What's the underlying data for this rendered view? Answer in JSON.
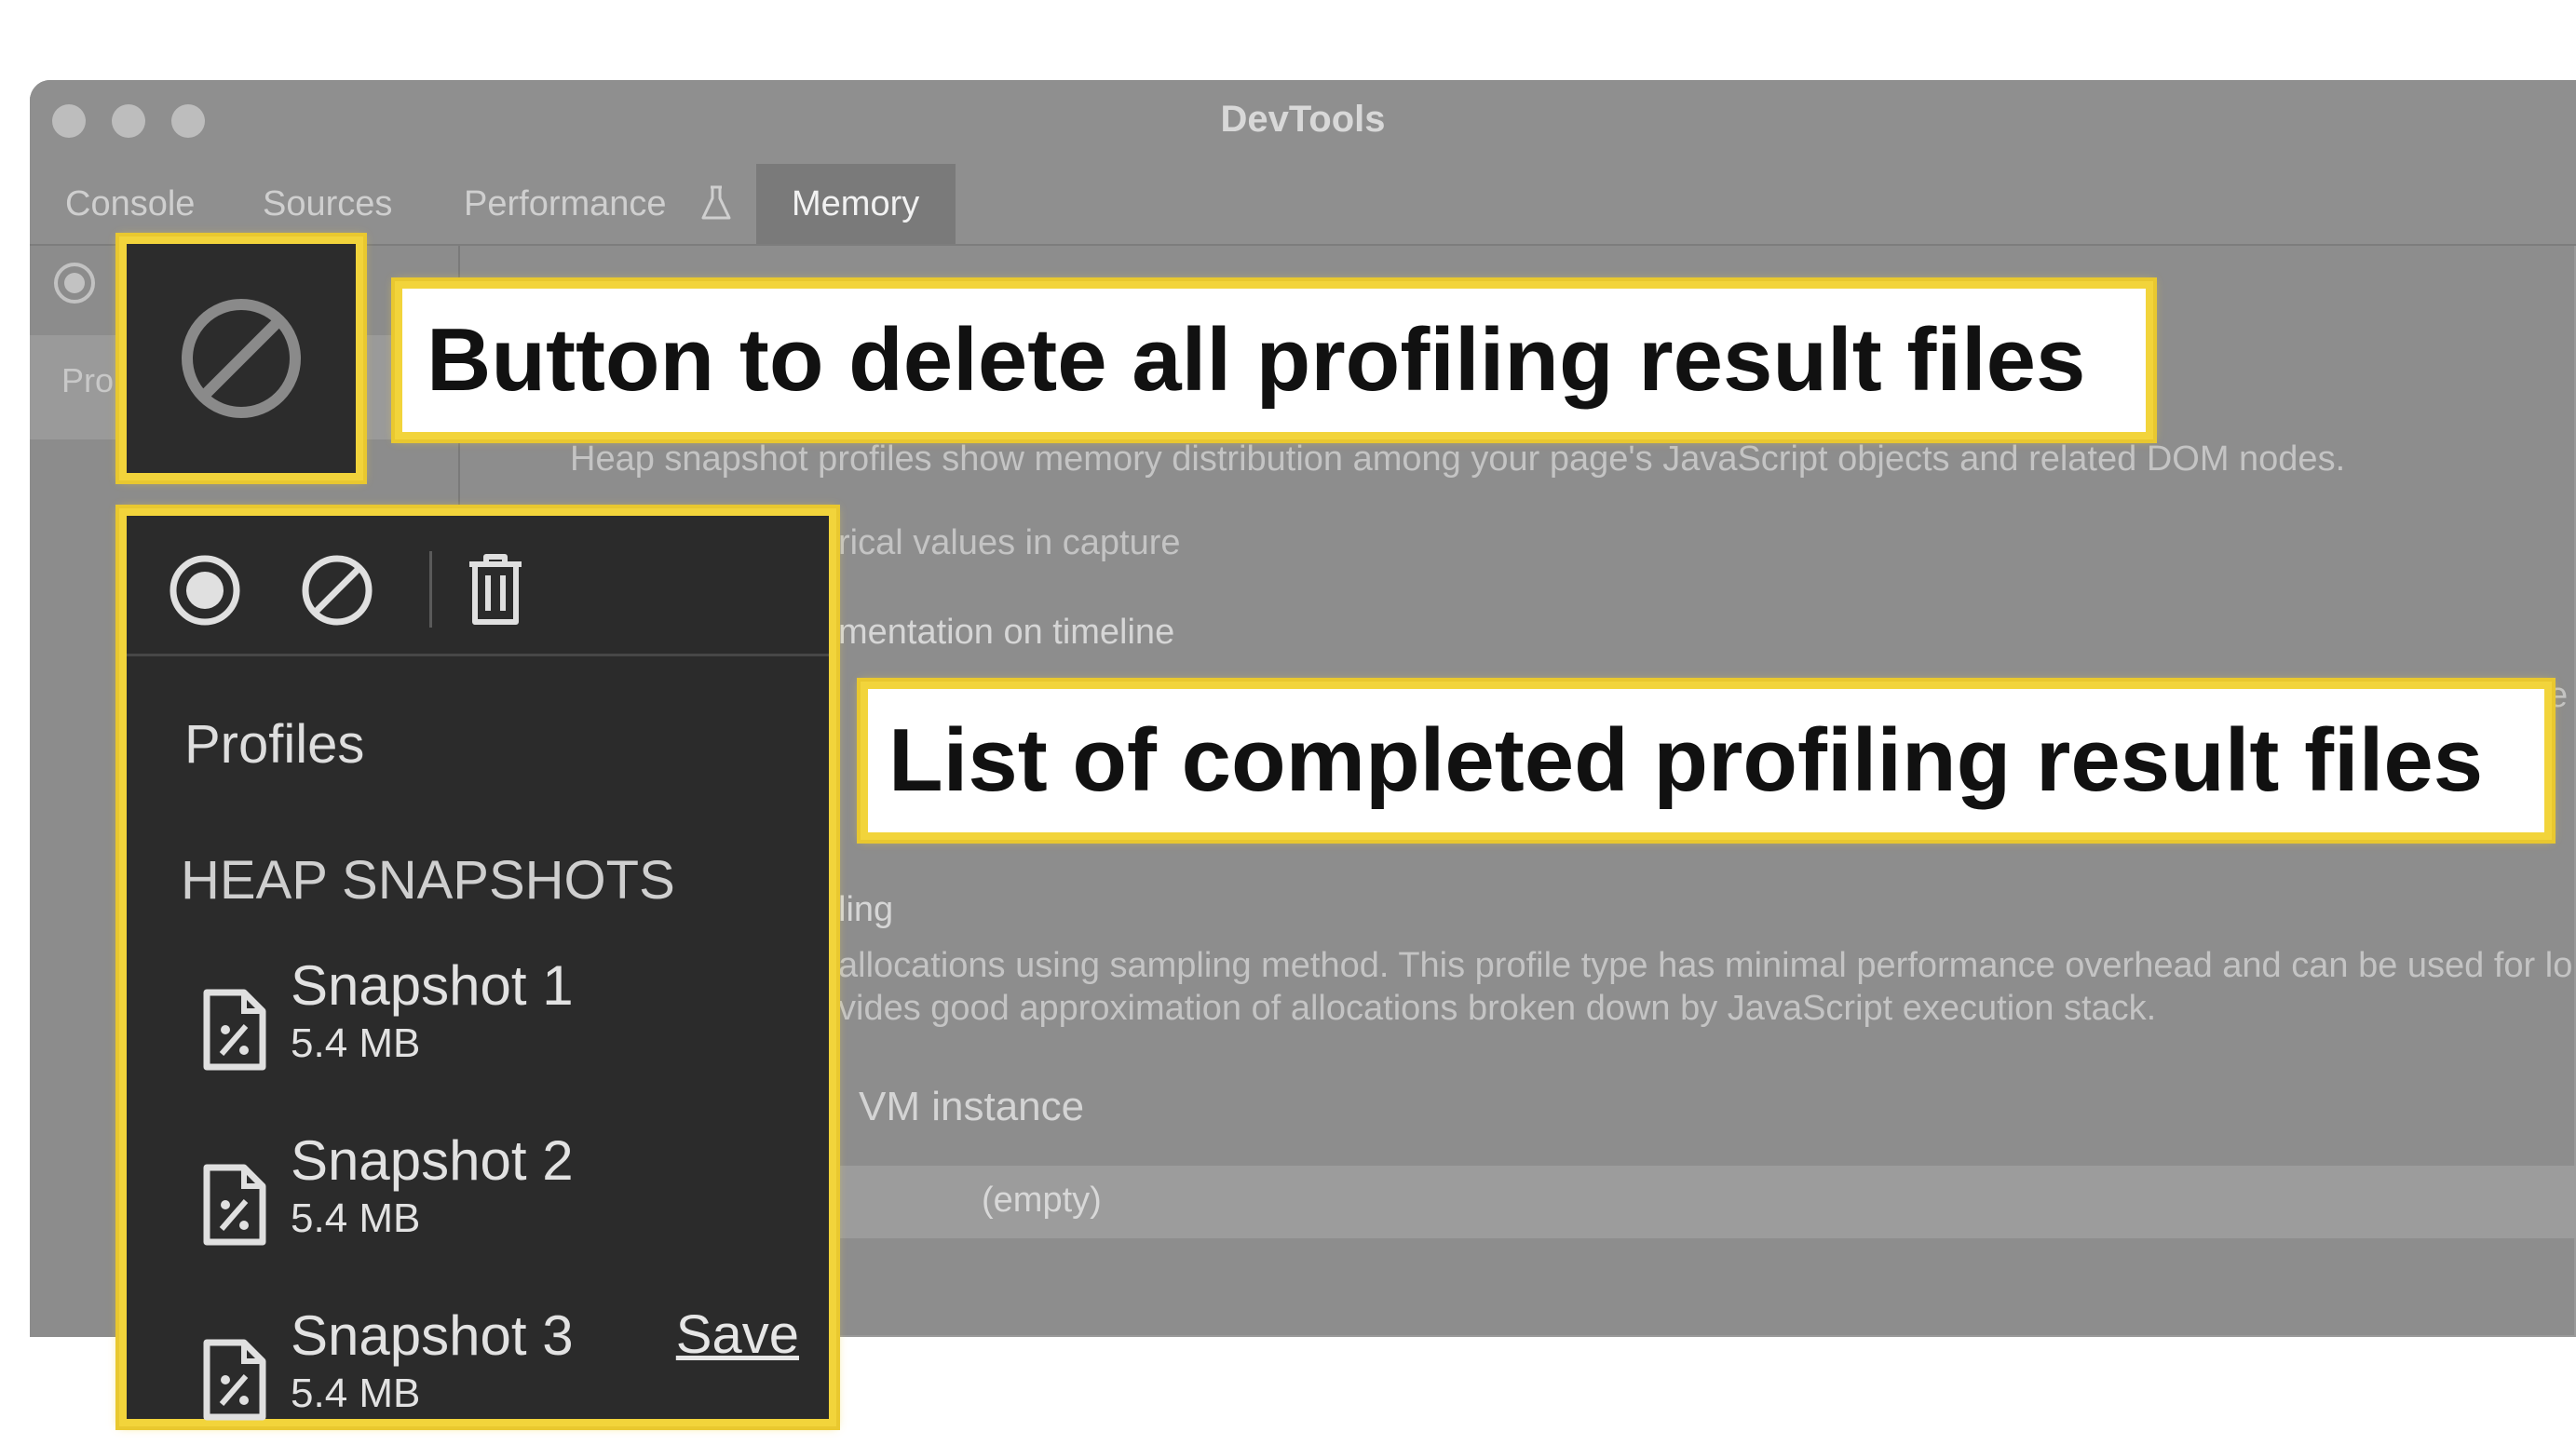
{
  "window": {
    "title": "DevTools"
  },
  "tabs": [
    {
      "label": "Console"
    },
    {
      "label": "Sources"
    },
    {
      "label": "Performance"
    },
    {
      "label": "Memory"
    }
  ],
  "sidebar": {
    "truncated_label": "Pro"
  },
  "background_text": {
    "description": "Heap snapshot profiles show memory distribution among your page's JavaScript objects and related DOM nodes.",
    "numerical": "rical values in capture",
    "instrumentation": "mentation on timeline",
    "sampling": "ling",
    "sampling_desc_1": "allocations using sampling method. This profile type has minimal performance overhead and can be used for lo",
    "sampling_desc_2": "vides good approximation of allocations broken down by JavaScript execution stack.",
    "vm_instance": "VM instance",
    "empty": "(empty)",
    "edge_e": "e"
  },
  "panel": {
    "profiles_heading": "Profiles",
    "section_heading": "HEAP SNAPSHOTS",
    "snapshots": [
      {
        "name": "Snapshot 1",
        "size": "5.4 MB"
      },
      {
        "name": "Snapshot 2",
        "size": "5.4 MB"
      },
      {
        "name": "Snapshot 3",
        "size": "5.4 MB",
        "action": "Save"
      }
    ]
  },
  "annotations": {
    "clear_button": "Button to delete all profiling result files",
    "profile_list": "List of completed profiling result files"
  },
  "colors": {
    "highlight": "#f2d43b",
    "panel_bg": "#2b2b2b"
  },
  "icons": [
    "record-icon",
    "clear-icon",
    "trash-icon",
    "snapshot-file-icon",
    "flask-icon"
  ]
}
